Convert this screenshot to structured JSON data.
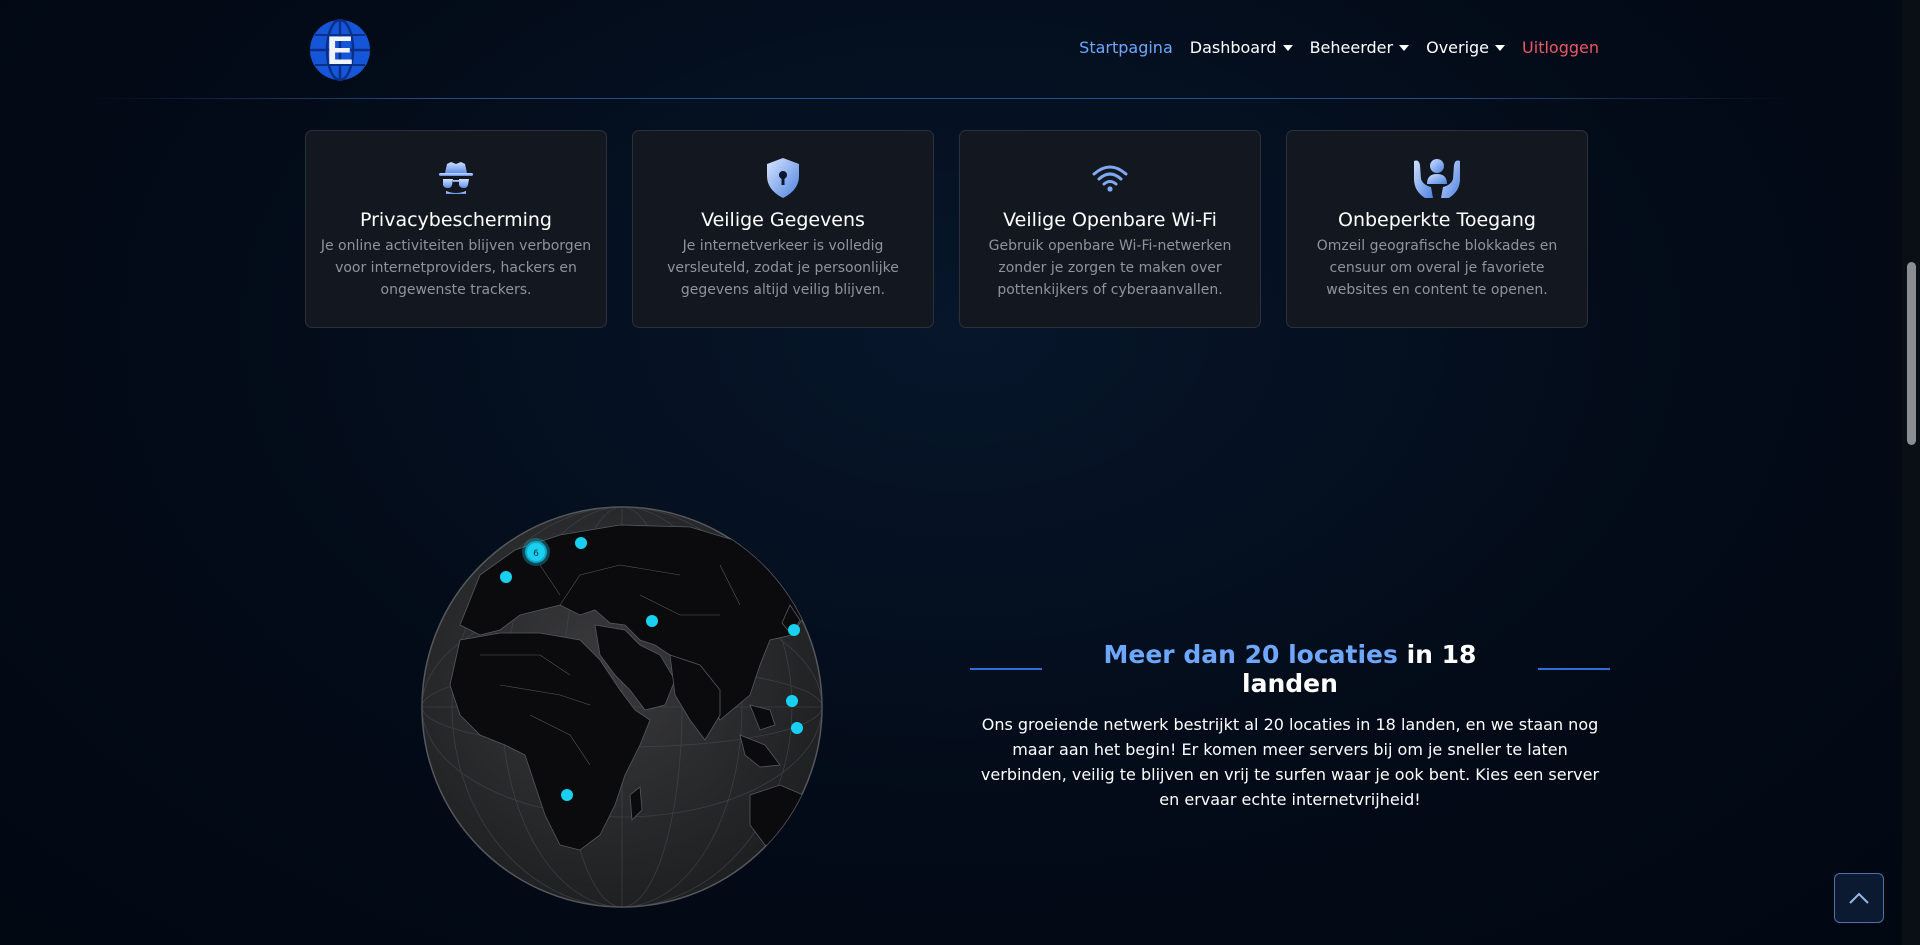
{
  "nav": {
    "items": [
      {
        "label": "Startpagina",
        "state": "active"
      },
      {
        "label": "Dashboard",
        "dropdown": true
      },
      {
        "label": "Beheerder",
        "dropdown": true
      },
      {
        "label": "Overige",
        "dropdown": true
      },
      {
        "label": "Uitloggen",
        "state": "logout"
      }
    ],
    "logo_letter": "E"
  },
  "features": [
    {
      "icon": "incognito-icon",
      "title": "Privacybescherming",
      "text": "Je online activiteiten blijven verborgen voor internetproviders, hackers en ongewenste trackers."
    },
    {
      "icon": "shield-lock-icon",
      "title": "Veilige Gegevens",
      "text": "Je internetverkeer is volledig versleuteld, zodat je persoonlijke gegevens altijd veilig blijven."
    },
    {
      "icon": "wifi-icon",
      "title": "Veilige Openbare Wi-Fi",
      "text": "Gebruik openbare Wi-Fi-netwerken zonder je zorgen te maken over pottenkijkers of cyberaanvallen."
    },
    {
      "icon": "hands-person-icon",
      "title": "Onbeperkte Toegang",
      "text": "Omzeil geografische blokkades en censuur om overal je favoriete websites en content te openen."
    }
  ],
  "locations": {
    "title_highlight": "Meer dan 20 locaties",
    "title_rest": " in 18 landen",
    "text": "Ons groeiende netwerk bestrijkt al 20 locaties in 18 landen, en we staan nog maar aan het begin! Er komen meer servers bij om je sneller te laten verbinden, veilig te blijven en vrij te surfen waar je ook bent. Kies een server en ervaar echte internetvrijheid!",
    "cluster_count": "6"
  },
  "colors": {
    "accent": "#6ea8fe",
    "logout": "#ea5a66",
    "marker": "#1ad0f0"
  }
}
